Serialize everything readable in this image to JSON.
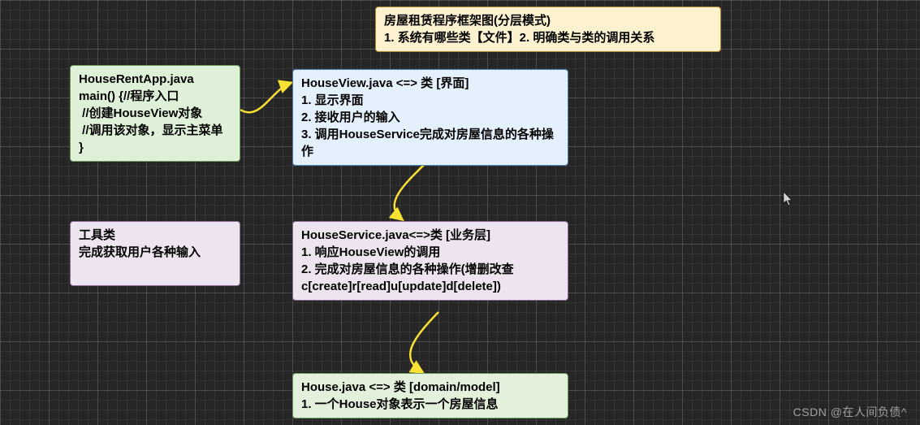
{
  "diagram": {
    "title": "房屋租赁程序框架图(分层模式)\n1. 系统有哪些类【文件】2. 明确类与类的调用关系",
    "nodes": {
      "app": "HouseRentApp.java\nmain() {//程序入口\n //创建HouseView对象\n //调用该对象，显示主菜单\n}",
      "view": "HouseView.java <=> 类 [界面]\n1. 显示界面\n2. 接收用户的输入\n3. 调用HouseService完成对房屋信息的各种操作",
      "util": "工具类\n完成获取用户各种输入",
      "service": "HouseService.java<=>类 [业务层]\n1. 响应HouseView的调用\n2. 完成对房屋信息的各种操作(增删改查 c[create]r[read]u[update]d[delete])",
      "model": "House.java <=> 类 [domain/model]\n1. 一个House对象表示一个房屋信息"
    }
  },
  "arrows": {
    "appToView": {
      "from": "app",
      "to": "view"
    },
    "viewToService": {
      "from": "view",
      "to": "service"
    },
    "serviceToModel": {
      "from": "service",
      "to": "model"
    }
  },
  "colors": {
    "arrow": "#f9e233"
  },
  "watermark": "CSDN @在人间负债^"
}
